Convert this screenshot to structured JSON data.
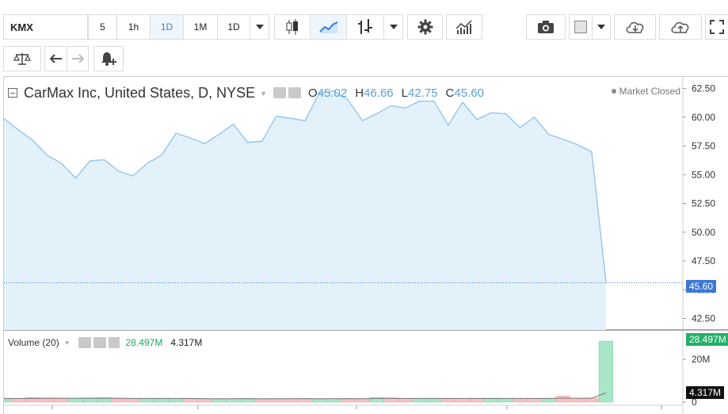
{
  "toolbar": {
    "symbol": "KMX",
    "intervals": [
      "5",
      "1h",
      "1D",
      "1M",
      "1D"
    ],
    "active_interval_index": 2
  },
  "legend": {
    "title": "CarMax Inc, United States, D, NYSE",
    "open_label": "O",
    "open": "45.02",
    "high_label": "H",
    "high": "46.66",
    "low_label": "L",
    "low": "42.75",
    "close_label": "C",
    "close": "45.60",
    "market_status": "Market Closed"
  },
  "price_axis": {
    "ticks": [
      "62.50",
      "60.00",
      "57.50",
      "55.00",
      "52.50",
      "50.00",
      "47.50",
      "45.00",
      "42.50"
    ],
    "last_price_label": "45.60"
  },
  "volume": {
    "label": "Volume (20)",
    "value": "28.497M",
    "ma_value": "4.317M",
    "axis_ticks": [
      "20M",
      "0"
    ],
    "last_volume_label": "28.497M",
    "ma_label": "4.317M"
  },
  "colors": {
    "line": "#8cc3ea",
    "area": "#e3f1fb",
    "price_tag": "#3d78d6",
    "vol_up": "#a8e6c7",
    "vol_down": "#f7c2c2",
    "vol_green_tag": "#22b06b"
  },
  "chart_data": {
    "type": "area",
    "title": "CarMax Inc, United States, D, NYSE",
    "ylim": [
      41.5,
      63.5
    ],
    "close": [
      59.9,
      58.9,
      58.0,
      56.7,
      56.0,
      54.7,
      56.2,
      56.3,
      55.3,
      54.9,
      56.0,
      56.7,
      58.6,
      58.2,
      57.7,
      58.5,
      59.4,
      57.8,
      57.9,
      60.1,
      59.9,
      59.7,
      62.1,
      62.3,
      61.5,
      59.7,
      60.3,
      61.0,
      60.8,
      61.4,
      61.4,
      59.3,
      61.3,
      59.8,
      60.4,
      60.3,
      59.1,
      60.0,
      58.5,
      58.1,
      57.6,
      57.0,
      45.6
    ],
    "volume": {
      "ylim": [
        0,
        30
      ],
      "values": [
        1.6,
        1.7,
        2.1,
        2.0,
        1.6,
        1.7,
        2.0,
        2.1,
        1.6,
        1.5,
        1.7,
        1.6,
        1.6,
        1.5,
        1.6,
        1.5,
        1.6,
        1.7,
        1.5,
        1.5,
        1.6,
        1.7,
        1.5,
        1.6,
        1.7,
        1.6,
        2.2,
        2.0,
        1.6,
        1.6,
        1.8,
        1.6,
        1.7,
        1.5,
        1.8,
        1.5,
        1.7,
        1.6,
        1.8,
        2.8,
        1.7,
        1.9,
        28.5
      ],
      "direction": [
        "up",
        "down",
        "down",
        "down",
        "down",
        "up",
        "up",
        "up",
        "down",
        "down",
        "up",
        "up",
        "up",
        "down",
        "down",
        "up",
        "up",
        "up",
        "down",
        "down",
        "down",
        "down",
        "up",
        "up",
        "down",
        "down",
        "up",
        "down",
        "down",
        "up",
        "up",
        "down",
        "down",
        "down",
        "up",
        "up",
        "down",
        "down",
        "up",
        "down",
        "down",
        "down",
        "up"
      ],
      "ma": [
        1.7,
        1.7,
        1.7,
        1.8,
        1.8,
        1.8,
        1.8,
        1.8,
        1.8,
        1.7,
        1.7,
        1.7,
        1.7,
        1.7,
        1.6,
        1.6,
        1.6,
        1.6,
        1.6,
        1.6,
        1.6,
        1.6,
        1.6,
        1.6,
        1.6,
        1.6,
        1.7,
        1.7,
        1.7,
        1.7,
        1.7,
        1.7,
        1.7,
        1.7,
        1.7,
        1.7,
        1.7,
        1.7,
        1.7,
        1.8,
        1.8,
        1.8,
        4.317
      ]
    }
  }
}
